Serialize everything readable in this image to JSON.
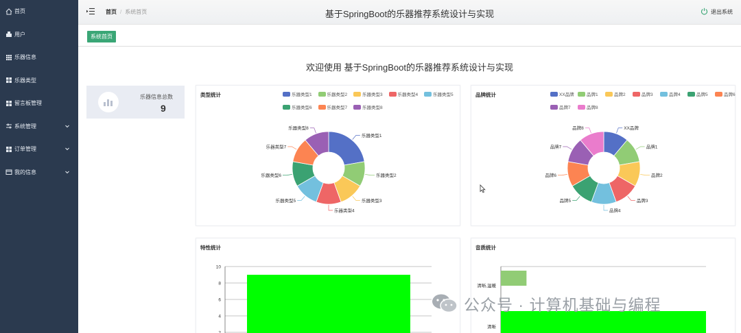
{
  "app": {
    "title": "基于SpringBoot的乐器推荐系统设计与实现"
  },
  "sidebar": {
    "items": [
      {
        "label": "首页",
        "icon": "home-icon",
        "has_children": false
      },
      {
        "label": "用户",
        "icon": "user-icon",
        "has_children": false
      },
      {
        "label": "乐器信息",
        "icon": "grid-icon",
        "has_children": false
      },
      {
        "label": "乐器类型",
        "icon": "apps-icon",
        "has_children": false
      },
      {
        "label": "留言板管理",
        "icon": "apps-icon",
        "has_children": false
      },
      {
        "label": "系统管理",
        "icon": "sliders-icon",
        "has_children": true
      },
      {
        "label": "订单管理",
        "icon": "grid-icon",
        "has_children": true
      },
      {
        "label": "我的信息",
        "icon": "card-icon",
        "has_children": true
      }
    ]
  },
  "header": {
    "breadcrumb": {
      "home": "首页",
      "current": "系统首页"
    },
    "logout_label": "退出系统"
  },
  "tags": {
    "active": "系统首页"
  },
  "main": {
    "welcome": "欢迎使用 基于SpringBoot的乐器推荐系统设计与实现",
    "stat": {
      "label": "乐器信息总数",
      "value": "9",
      "icon": "bar-chart-icon"
    }
  },
  "colors": {
    "sidebar_bg": "#2b3a4f",
    "accent_green": "#3aa676",
    "palette": [
      "#5470c6",
      "#91cc75",
      "#fac858",
      "#ee6666",
      "#73c0de",
      "#3ba272",
      "#fc8452",
      "#9a60b4",
      "#ea7ccc"
    ]
  },
  "watermark": {
    "text": "公众号 · 计算机基础与编程",
    "icon": "wechat-icon"
  },
  "chart_data": [
    {
      "type": "pie",
      "title": "类型统计",
      "categories": [
        "乐器类型1",
        "乐器类型2",
        "乐器类型3",
        "乐器类型4",
        "乐器类型5",
        "乐器类型6",
        "乐器类型7",
        "乐器类型8"
      ],
      "values": [
        2,
        1,
        1,
        1,
        1,
        1,
        1,
        1
      ],
      "legend": "top-right"
    },
    {
      "type": "pie",
      "title": "品牌统计",
      "categories": [
        "XX品牌",
        "品牌1",
        "品牌2",
        "品牌3",
        "品牌4",
        "品牌5",
        "品牌6",
        "品牌7",
        "品牌8"
      ],
      "values": [
        1,
        1,
        1,
        1,
        1,
        1,
        1,
        1,
        1
      ],
      "legend": "top-right"
    },
    {
      "type": "bar",
      "title": "特性统计",
      "categories": [
        ""
      ],
      "values": [
        9
      ],
      "ylim": [
        0,
        10
      ],
      "yticks": [
        "10",
        "8",
        "6",
        "4",
        "2"
      ],
      "grid": true
    },
    {
      "type": "bar",
      "orientation": "horizontal",
      "title": "音质统计",
      "categories": [
        "清晰,温暖",
        "清晰"
      ],
      "values": [
        1,
        8
      ],
      "grid": true
    }
  ]
}
